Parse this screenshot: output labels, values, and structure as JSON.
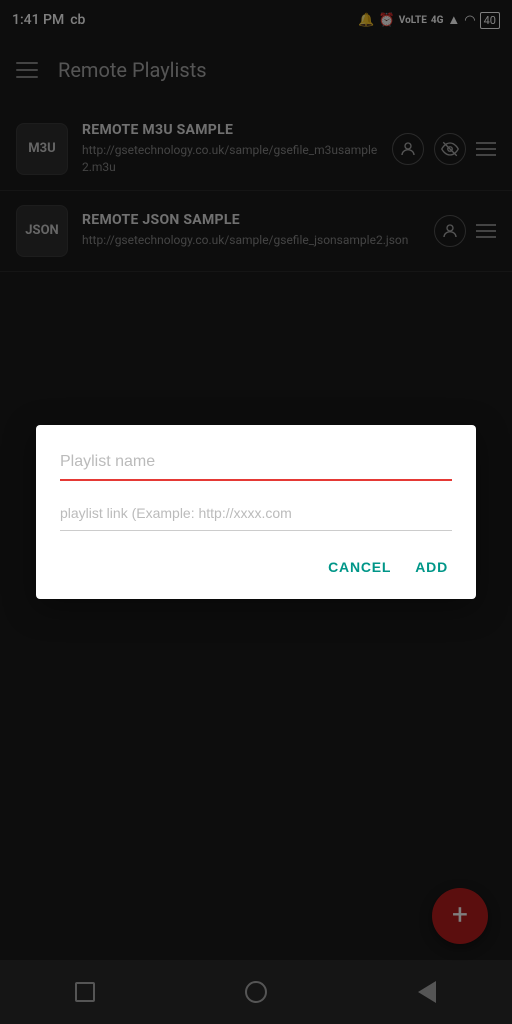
{
  "statusBar": {
    "time": "1:41 PM",
    "carrier": "cb",
    "icons": [
      "alarm",
      "clock",
      "volte",
      "4g",
      "signal",
      "wifi",
      "battery40"
    ]
  },
  "appBar": {
    "title": "Remote Playlists",
    "menuIcon": "hamburger"
  },
  "playlists": [
    {
      "id": "m3u",
      "badge": "M3U",
      "name": "REMOTE M3U SAMPLE",
      "url": "http://gsetechnology.co.uk/sample/gsefile_m3usample2.m3u",
      "hasEyeIcon": true,
      "hasPersonIcon": true,
      "hasMenuIcon": true
    },
    {
      "id": "json",
      "badge": "JSON",
      "name": "REMOTE JSON SAMPLE",
      "url": "http://gsetechnology.co.uk/sample/gsefile_jsonsample2.json",
      "hasEyeIcon": false,
      "hasPersonIcon": true,
      "hasMenuIcon": true
    }
  ],
  "dialog": {
    "nameField": {
      "placeholder": "Playlist name",
      "value": ""
    },
    "linkField": {
      "placeholder": "playlist link (Example: http://xxxx.com",
      "value": ""
    },
    "cancelLabel": "CANCEL",
    "addLabel": "ADD"
  },
  "fab": {
    "label": "+"
  },
  "navBar": {
    "buttons": [
      "square",
      "circle",
      "back"
    ]
  }
}
